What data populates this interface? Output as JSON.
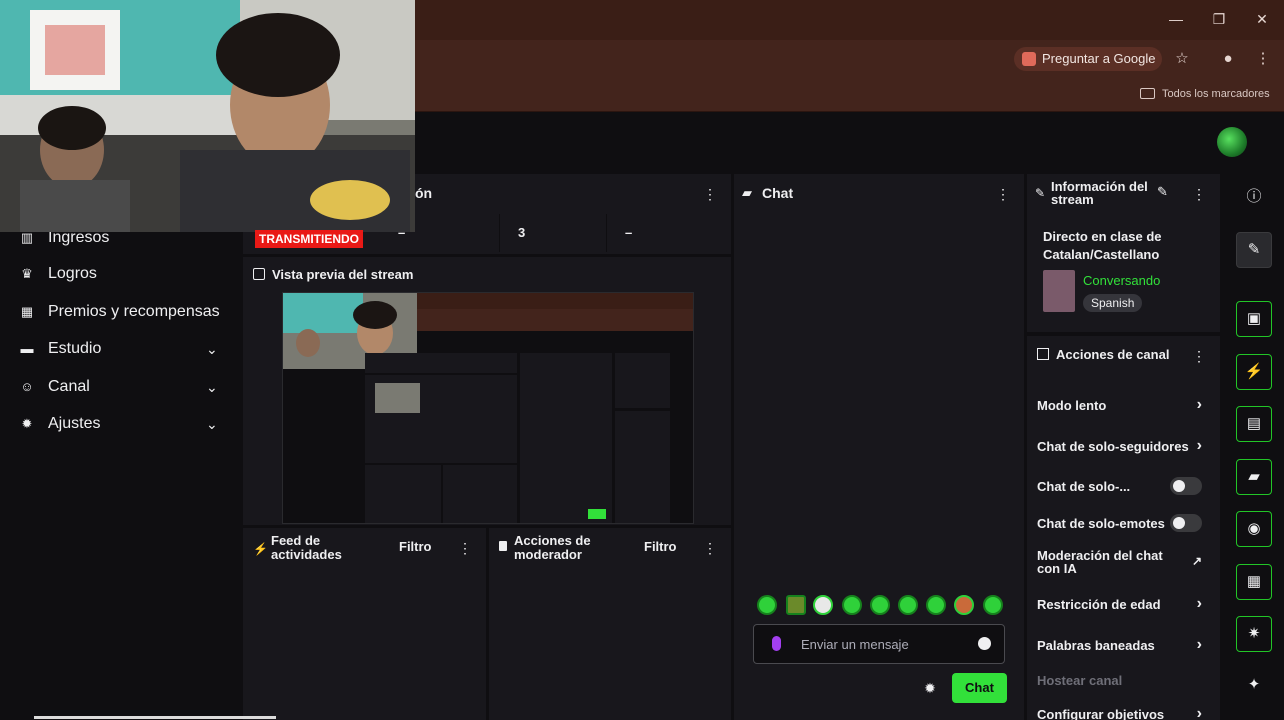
{
  "browser": {
    "ask_google": "Preguntar a Google",
    "bookmarks_all": "Todos los marcadores",
    "minimize": "—",
    "restore": "❐",
    "close": "✕"
  },
  "nav": {
    "items": [
      {
        "label": "Ingresos",
        "icon": "chart-icon"
      },
      {
        "label": "Logros",
        "icon": "trophy-icon"
      },
      {
        "label": "Premios y recompensas",
        "icon": "gift-icon"
      },
      {
        "label": "Estudio",
        "icon": "gear-icon",
        "chevron": "⌄"
      },
      {
        "label": "Canal",
        "icon": "people-icon",
        "chevron": "⌄"
      },
      {
        "label": "Ajustes",
        "icon": "gear-icon",
        "chevron": "⌄"
      }
    ]
  },
  "stats": {
    "title_fragment": "ón",
    "live_badge": "TRANSMITIENDO",
    "cells": [
      "–",
      "3",
      "–"
    ]
  },
  "preview": {
    "title": "Vista previa del stream"
  },
  "feed": {
    "title": "Feed de actividades",
    "filter": "Filtro"
  },
  "mod_actions": {
    "title": "Acciones de moderador",
    "filter": "Filtro"
  },
  "chat": {
    "title": "Chat",
    "input_placeholder": "Enviar un mensaje",
    "send_label": "Chat"
  },
  "stream_info": {
    "title": "Información del stream",
    "stream_title": "Directo en clase de Catalan/Castellano",
    "category": "Conversando",
    "language_tag": "Spanish"
  },
  "channel_actions": {
    "title": "Acciones de canal",
    "rows": [
      {
        "label": "Modo lento",
        "control": "arrow"
      },
      {
        "label": "Chat de solo-seguidores",
        "control": "arrow"
      },
      {
        "label": "Chat de solo-...",
        "control": "toggle"
      },
      {
        "label": "Chat de solo-emotes",
        "control": "toggle"
      },
      {
        "label": "Moderación del chat con IA",
        "control": "external"
      },
      {
        "label": "Restricción de edad",
        "control": "arrow"
      },
      {
        "label": "Palabras baneadas",
        "control": "arrow"
      },
      {
        "label": "Hostear canal",
        "control": "none"
      },
      {
        "label": "Configurar objetivos",
        "control": "arrow"
      }
    ]
  },
  "colors": {
    "accent_green": "#32e03a",
    "live_red": "#e91916",
    "category_green": "#32e03a"
  }
}
